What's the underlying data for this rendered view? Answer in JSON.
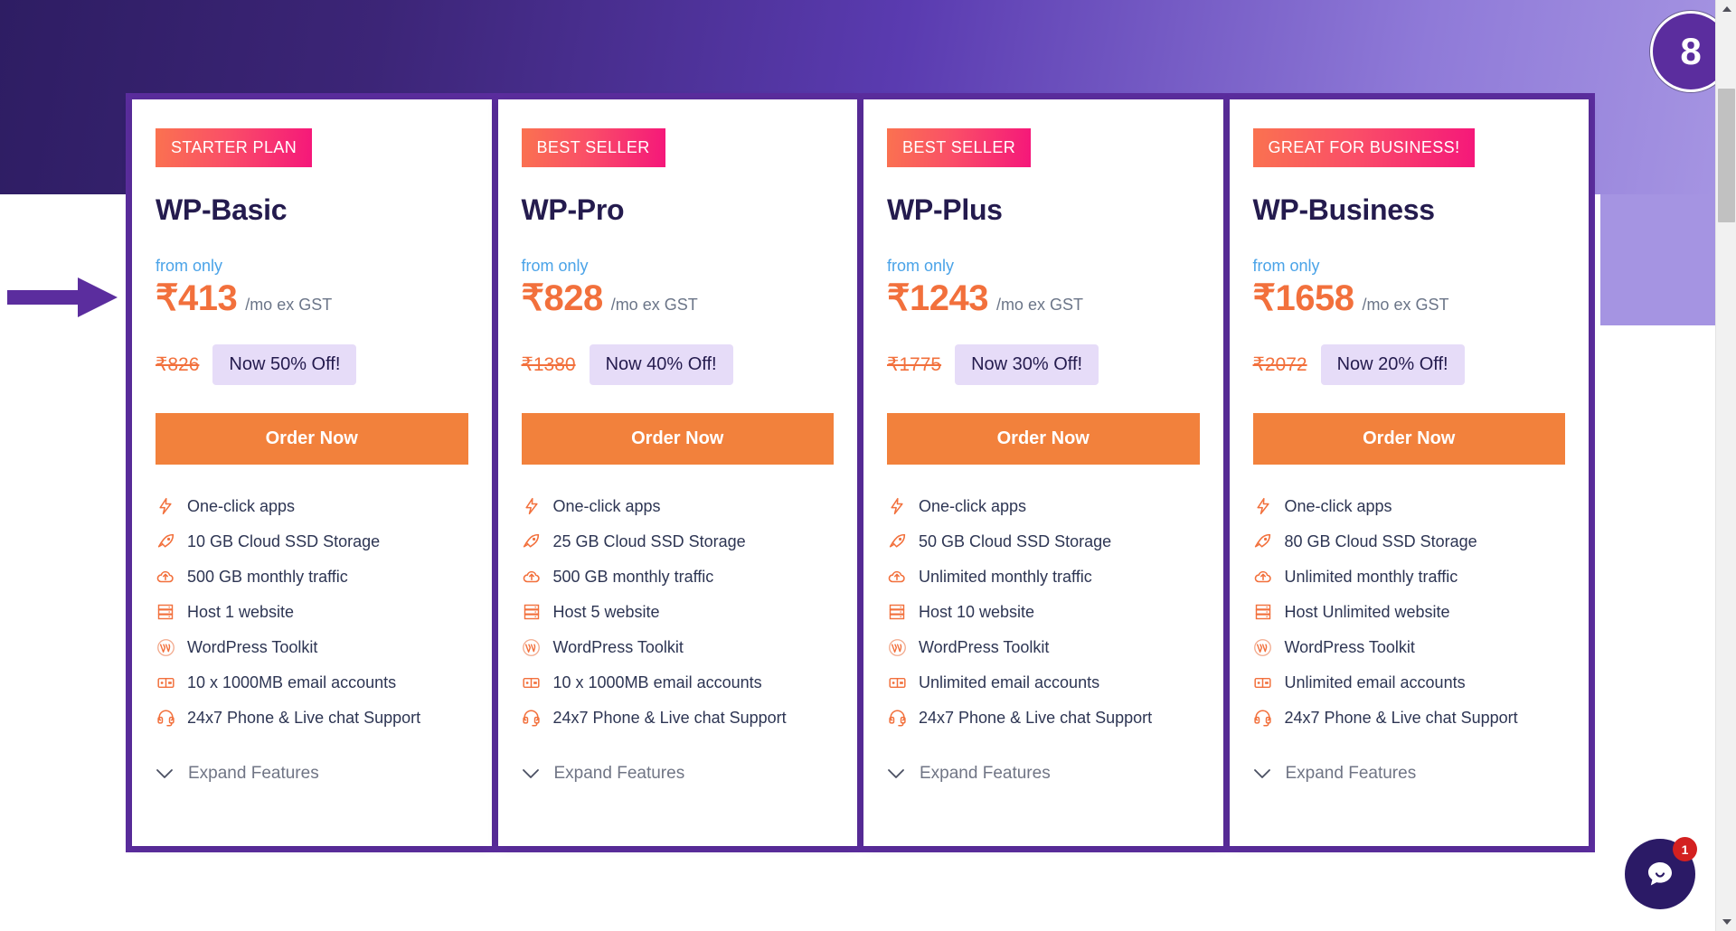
{
  "annotations": {
    "step_badge": "8",
    "arrow_color": "#5b2d9e"
  },
  "colors": {
    "frame_purple": "#5b2d9e",
    "ribbon_start": "#fa7250",
    "ribbon_end": "#f5177a",
    "price_orange": "#f2703c",
    "button_orange": "#f2813c",
    "heading_navy": "#241b4e",
    "from_only_blue": "#4aa3e8",
    "pill_lavender": "#e6dcf8"
  },
  "common": {
    "from_only_label": "from only",
    "price_period": "/mo ex GST",
    "order_button_label": "Order Now",
    "expand_label": "Expand Features"
  },
  "plans": [
    {
      "ribbon": "STARTER PLAN",
      "name": "WP-Basic",
      "from_only": "from only",
      "price": "₹413",
      "period": "/mo ex GST",
      "old_price": "₹826",
      "discount": "Now 50% Off!",
      "order": "Order Now",
      "expand": "Expand Features",
      "features": [
        {
          "icon": "lightning-icon",
          "text": "One-click apps"
        },
        {
          "icon": "rocket-icon",
          "text": "10 GB Cloud SSD Storage"
        },
        {
          "icon": "cloud-upload-icon",
          "text": "500 GB monthly traffic"
        },
        {
          "icon": "server-icon",
          "text": "Host 1 website"
        },
        {
          "icon": "wordpress-icon",
          "text": "WordPress Toolkit"
        },
        {
          "icon": "mailbox-icon",
          "text": "10 x 1000MB email accounts"
        },
        {
          "icon": "headset-support-icon",
          "text": "24x7 Phone & Live chat Support"
        }
      ]
    },
    {
      "ribbon": "BEST SELLER",
      "name": "WP-Pro",
      "from_only": "from only",
      "price": "₹828",
      "period": "/mo ex GST",
      "old_price": "₹1380",
      "discount": "Now 40% Off!",
      "order": "Order Now",
      "expand": "Expand Features",
      "features": [
        {
          "icon": "lightning-icon",
          "text": "One-click apps"
        },
        {
          "icon": "rocket-icon",
          "text": "25 GB Cloud SSD Storage"
        },
        {
          "icon": "cloud-upload-icon",
          "text": "500 GB monthly traffic"
        },
        {
          "icon": "server-icon",
          "text": "Host 5 website"
        },
        {
          "icon": "wordpress-icon",
          "text": "WordPress Toolkit"
        },
        {
          "icon": "mailbox-icon",
          "text": "10 x 1000MB email accounts"
        },
        {
          "icon": "headset-support-icon",
          "text": "24x7 Phone & Live chat Support"
        }
      ]
    },
    {
      "ribbon": "BEST SELLER",
      "name": "WP-Plus",
      "from_only": "from only",
      "price": "₹1243",
      "period": "/mo ex GST",
      "old_price": "₹1775",
      "discount": "Now 30% Off!",
      "order": "Order Now",
      "expand": "Expand Features",
      "features": [
        {
          "icon": "lightning-icon",
          "text": "One-click apps"
        },
        {
          "icon": "rocket-icon",
          "text": "50 GB Cloud SSD Storage"
        },
        {
          "icon": "cloud-upload-icon",
          "text": "Unlimited monthly traffic"
        },
        {
          "icon": "server-icon",
          "text": "Host 10 website"
        },
        {
          "icon": "wordpress-icon",
          "text": "WordPress Toolkit"
        },
        {
          "icon": "mailbox-icon",
          "text": "Unlimited email accounts"
        },
        {
          "icon": "headset-support-icon",
          "text": "24x7 Phone & Live chat Support"
        }
      ]
    },
    {
      "ribbon": "GREAT FOR BUSINESS!",
      "name": "WP-Business",
      "from_only": "from only",
      "price": "₹1658",
      "period": "/mo ex GST",
      "old_price": "₹2072",
      "discount": "Now 20% Off!",
      "order": "Order Now",
      "expand": "Expand Features",
      "features": [
        {
          "icon": "lightning-icon",
          "text": "One-click apps"
        },
        {
          "icon": "rocket-icon",
          "text": "80 GB Cloud SSD Storage"
        },
        {
          "icon": "cloud-upload-icon",
          "text": "Unlimited monthly traffic"
        },
        {
          "icon": "server-icon",
          "text": "Host Unlimited website"
        },
        {
          "icon": "wordpress-icon",
          "text": "WordPress Toolkit"
        },
        {
          "icon": "mailbox-icon",
          "text": "Unlimited email accounts"
        },
        {
          "icon": "headset-support-icon",
          "text": "24x7 Phone & Live chat Support"
        }
      ]
    }
  ],
  "chat_widget": {
    "icon": "chat-bubble-icon",
    "unread_count": "1"
  },
  "scrollbar": {
    "up_icon": "scroll-up-arrow-icon",
    "down_icon": "scroll-down-arrow-icon"
  }
}
